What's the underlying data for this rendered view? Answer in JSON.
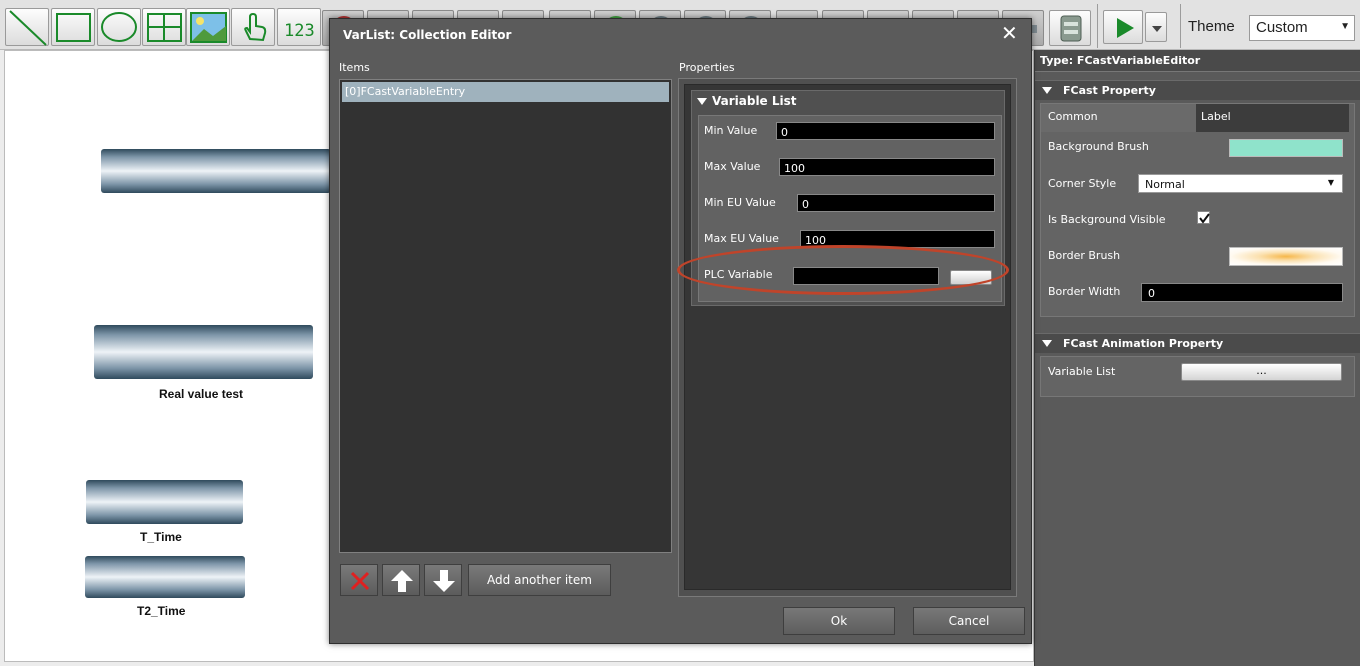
{
  "toolbar": {
    "tools": [
      "line-tool",
      "rectangle-tool",
      "ellipse-tool",
      "grid-tool",
      "image-tool",
      "touch-tool",
      "numeric-display-tool"
    ],
    "numeric_glyph": "123",
    "theme_label": "Theme",
    "theme_value": "Custom"
  },
  "canvas": {
    "labels": {
      "real_value": "Real value test",
      "t_time": "T_Time",
      "t2_time": "T2_Time"
    }
  },
  "dialog": {
    "title": "VarList: Collection Editor",
    "items_label": "Items",
    "properties_label": "Properties",
    "items": [
      "[0]FCastVariableEntry"
    ],
    "variable_list_header": "Variable List",
    "fields": {
      "min_value": {
        "label": "Min Value",
        "value": "0"
      },
      "max_value": {
        "label": "Max Value",
        "value": "100"
      },
      "min_eu_value": {
        "label": "Min EU Value",
        "value": "0"
      },
      "max_eu_value": {
        "label": "Max EU Value",
        "value": "100"
      },
      "plc_variable": {
        "label": "PLC Variable",
        "value": ""
      }
    },
    "add_item_label": "Add another item",
    "ok_label": "Ok",
    "cancel_label": "Cancel",
    "highlight_color": "#c0442a"
  },
  "properties_panel": {
    "type_line": "Type: FCastVariableEditor",
    "fcast_property_header": "FCast Property",
    "tab_common": "Common",
    "tab_label": "Label",
    "background_brush_label": "Background Brush",
    "background_brush_color": "#8fe3cb",
    "corner_style_label": "Corner Style",
    "corner_style_value": "Normal",
    "is_background_visible_label": "Is Background Visible",
    "is_background_visible": true,
    "border_brush_label": "Border Brush",
    "border_width_label": "Border Width",
    "border_width_value": "0",
    "animation_header": "FCast Animation Property",
    "variable_list_label": "Variable List",
    "variable_list_button": "..."
  }
}
